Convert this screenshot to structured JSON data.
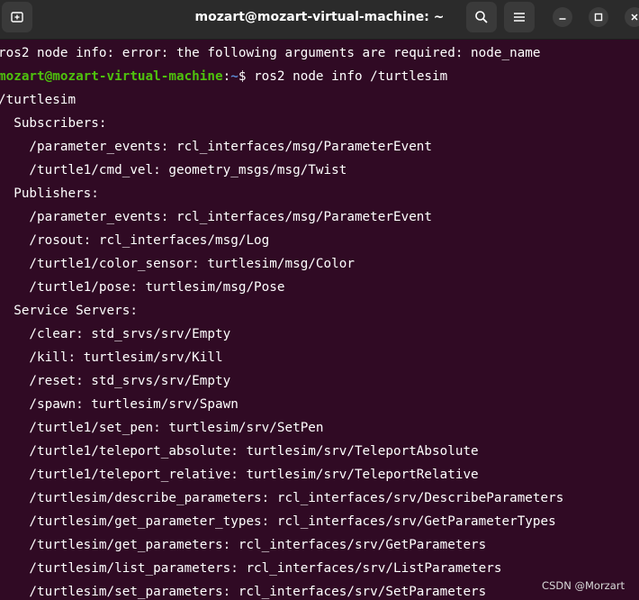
{
  "window": {
    "title": "mozart@mozart-virtual-machine: ~"
  },
  "icons": {
    "new_tab": "new-tab-icon",
    "search": "search-icon",
    "menu": "hamburger-menu-icon",
    "minimize": "minimize-icon",
    "maximize": "maximize-icon",
    "close": "close-icon"
  },
  "colors": {
    "background": "#300a24",
    "prompt_user": "#4ec20d",
    "prompt_path": "#5b8ad4",
    "text": "#ffffff"
  },
  "terminal": {
    "error_line": "ros2 node info: error: the following arguments are required: node_name",
    "prompt": {
      "user_host": "mozart@mozart-virtual-machine",
      "separator": ":",
      "path": "~",
      "symbol": "$ ",
      "command": "ros2 node info /turtlesim"
    },
    "output": [
      "/turtlesim",
      "  Subscribers:",
      "    /parameter_events: rcl_interfaces/msg/ParameterEvent",
      "    /turtle1/cmd_vel: geometry_msgs/msg/Twist",
      "  Publishers:",
      "    /parameter_events: rcl_interfaces/msg/ParameterEvent",
      "    /rosout: rcl_interfaces/msg/Log",
      "    /turtle1/color_sensor: turtlesim/msg/Color",
      "    /turtle1/pose: turtlesim/msg/Pose",
      "  Service Servers:",
      "    /clear: std_srvs/srv/Empty",
      "    /kill: turtlesim/srv/Kill",
      "    /reset: std_srvs/srv/Empty",
      "    /spawn: turtlesim/srv/Spawn",
      "    /turtle1/set_pen: turtlesim/srv/SetPen",
      "    /turtle1/teleport_absolute: turtlesim/srv/TeleportAbsolute",
      "    /turtle1/teleport_relative: turtlesim/srv/TeleportRelative",
      "    /turtlesim/describe_parameters: rcl_interfaces/srv/DescribeParameters",
      "    /turtlesim/get_parameter_types: rcl_interfaces/srv/GetParameterTypes",
      "    /turtlesim/get_parameters: rcl_interfaces/srv/GetParameters",
      "    /turtlesim/list_parameters: rcl_interfaces/srv/ListParameters",
      "    /turtlesim/set_parameters: rcl_interfaces/srv/SetParameters"
    ]
  },
  "watermark": "CSDN @Morzart"
}
